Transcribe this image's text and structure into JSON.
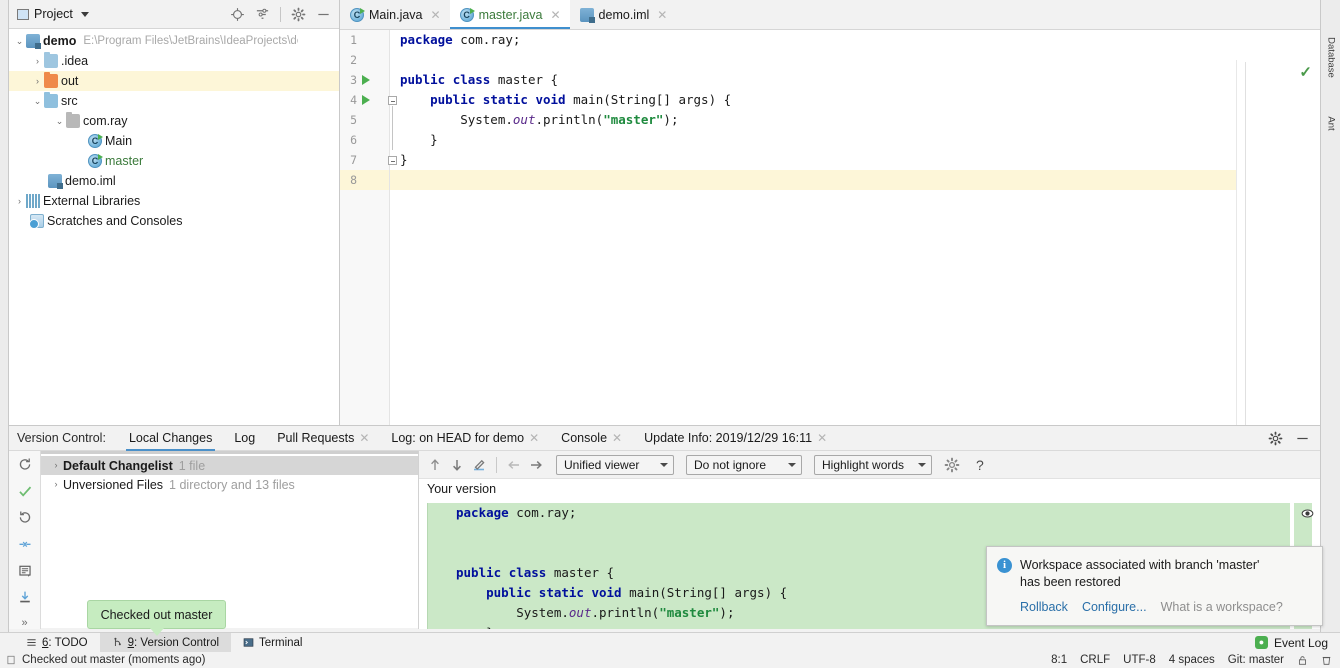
{
  "project_panel": {
    "title": "Project",
    "icons": [
      "locate-icon",
      "collapse-all-icon",
      "settings-gear-icon",
      "hide-icon"
    ],
    "tree": [
      {
        "label": "demo",
        "path": "E:\\Program Files\\JetBrains\\IdeaProjects\\der",
        "icon": "module-icon",
        "indent": 0,
        "arrow": "⌄",
        "bold": true
      },
      {
        "label": ".idea",
        "icon": "folder-icon",
        "indent": 1,
        "arrow": "›"
      },
      {
        "label": "out",
        "icon": "folder-orange-icon",
        "indent": 1,
        "arrow": "›",
        "highlight": true
      },
      {
        "label": "src",
        "icon": "folder-source-icon",
        "indent": 1,
        "arrow": "⌄"
      },
      {
        "label": "com.ray",
        "icon": "package-icon",
        "indent": 2,
        "arrow": "⌄"
      },
      {
        "label": "Main",
        "icon": "java-class-icon",
        "indent": 3,
        "arrow": ""
      },
      {
        "label": "master",
        "icon": "java-class-icon",
        "indent": 3,
        "arrow": "",
        "green": true
      },
      {
        "label": "demo.iml",
        "icon": "iml-file-icon",
        "indent": 1,
        "arrow": ""
      },
      {
        "label": "External Libraries",
        "icon": "library-icon",
        "indent": 0,
        "arrow": "›"
      },
      {
        "label": "Scratches and Consoles",
        "icon": "scratches-icon",
        "indent": 0,
        "arrow": ""
      }
    ]
  },
  "editor": {
    "tabs": [
      {
        "label": "Main.java",
        "icon": "java-class-icon",
        "active": false,
        "green": false
      },
      {
        "label": "master.java",
        "icon": "java-class-icon",
        "active": true,
        "green": true
      },
      {
        "label": "demo.iml",
        "icon": "iml-file-icon",
        "active": false,
        "green": false
      }
    ],
    "lines": [
      {
        "n": "1",
        "run": false
      },
      {
        "n": "2",
        "run": false
      },
      {
        "n": "3",
        "run": true
      },
      {
        "n": "4",
        "run": true
      },
      {
        "n": "5",
        "run": false
      },
      {
        "n": "6",
        "run": false
      },
      {
        "n": "7",
        "run": false
      },
      {
        "n": "8",
        "run": false,
        "highlight": true
      }
    ],
    "code": {
      "l1_kw": "package",
      "l1_rest": " com.ray;",
      "l3_kw1": "public",
      "l3_kw2": "class",
      "l3_rest": " master {",
      "l4_kw1": "public",
      "l4_kw2": "static",
      "l4_kw3": "void",
      "l4_rest": " main(String[] args) {",
      "l5_pre": "        System.",
      "l5_fld": "out",
      "l5_mid": ".println(",
      "l5_str": "\"master\"",
      "l5_end": ");",
      "l6": "    }",
      "l7": "}"
    }
  },
  "right_strip": {
    "labels": [
      "Database",
      "Ant"
    ]
  },
  "version_control": {
    "lead_label": "Version Control:",
    "tabs": [
      {
        "label": "Local Changes",
        "active": true,
        "closable": false
      },
      {
        "label": "Log",
        "active": false,
        "closable": false
      },
      {
        "label": "Pull Requests",
        "active": false,
        "closable": true
      },
      {
        "label": "Log: on HEAD for demo",
        "active": false,
        "closable": true
      },
      {
        "label": "Console",
        "active": false,
        "closable": true
      },
      {
        "label": "Update Info: 2019/12/29 16:11",
        "active": false,
        "closable": true
      }
    ],
    "toolbar_icons": [
      "refresh-icon",
      "commit-check-icon",
      "rollback-icon",
      "shelve-icon",
      "diff-icon",
      "update-icon",
      "expand-more-icon"
    ],
    "changelist": [
      {
        "name": "Default Changelist",
        "sub": "1 file",
        "arrow": "›",
        "selected": true
      },
      {
        "name": "Unversioned Files",
        "sub": "1 directory and 13 files",
        "arrow": "›",
        "selected": false
      }
    ],
    "diff_toolbar": {
      "icons": [
        "prev-difference-icon",
        "next-difference-icon",
        "edit-source-icon",
        "previous-icon",
        "next-icon"
      ],
      "selects": [
        "Unified viewer",
        "Do not ignore",
        "Highlight words"
      ],
      "settings_icon": "settings-gear-icon",
      "help_icon": "help-icon"
    },
    "version_label": "Your version",
    "diff_code": {
      "d1_kw": "package",
      "d1_rest": " com.ray;",
      "d3_kw1": "public",
      "d3_kw2": "class",
      "d3_rest": " master {",
      "d4_kw1": "public",
      "d4_kw2": "static",
      "d4_kw3": "void",
      "d4_rest": " main(String[] args) {",
      "d5_pre": "        System.",
      "d5_fld": "out",
      "d5_mid": ".println(",
      "d5_str": "\"master\"",
      "d5_end": ");",
      "d6": "    }",
      "d7": "}"
    }
  },
  "notification": {
    "icon": "info-icon",
    "message_line1": "Workspace associated with branch 'master'",
    "message_line2": "has been restored",
    "actions": [
      "Rollback",
      "Configure...",
      "What is a workspace?"
    ]
  },
  "tooltip": {
    "text": "Checked out master"
  },
  "toolwindow_bar": {
    "tabs": [
      {
        "num": "6",
        "label": ": TODO",
        "icon": "todo-icon",
        "active": false
      },
      {
        "num": "9",
        "label": ": Version Control",
        "icon": "branch-icon",
        "active": true
      },
      {
        "num": "",
        "label": "Terminal",
        "icon": "terminal-icon",
        "active": false
      }
    ],
    "event_log": "Event Log"
  },
  "status_bar": {
    "message": "Checked out master (moments ago)",
    "right_items": [
      "8:1",
      "CRLF",
      "UTF-8",
      "4 spaces",
      "Git: master"
    ]
  },
  "colors": {
    "diff_green": "#cbe8c7",
    "tooltip_green": "#c6ecc0",
    "accent_blue": "#3f8fce",
    "highlight_yellow": "#fdf6d8"
  }
}
